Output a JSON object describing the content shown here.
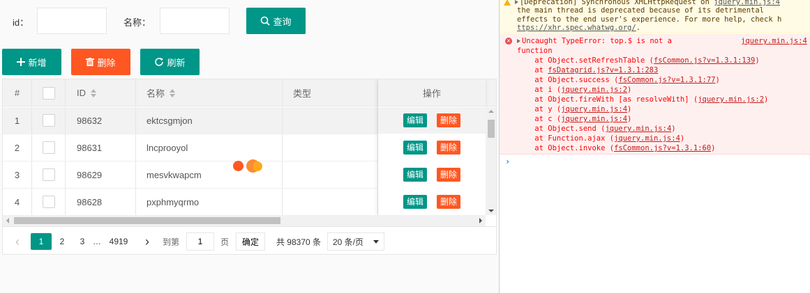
{
  "search": {
    "id_label": "id：",
    "id_value": "",
    "name_label": "名称：",
    "name_value": "",
    "query_button": "查询"
  },
  "toolbar": {
    "add_button": "新增",
    "delete_button": "删除",
    "refresh_button": "刷新"
  },
  "table": {
    "columns": {
      "index": "#",
      "id": "ID",
      "name": "名称",
      "type": "类型",
      "ops": "操作"
    },
    "rows": [
      {
        "index": "1",
        "id": "98632",
        "name": "ektcsgmjon",
        "type": ""
      },
      {
        "index": "2",
        "id": "98631",
        "name": "lncprooyol",
        "type": ""
      },
      {
        "index": "3",
        "id": "98629",
        "name": "mesvkwapcm",
        "type": ""
      },
      {
        "index": "4",
        "id": "98628",
        "name": "pxphmyqrmo",
        "type": ""
      }
    ],
    "edit_label": "编辑",
    "delete_label": "删除"
  },
  "pager": {
    "prev": "‹",
    "pages": [
      "1",
      "2",
      "3"
    ],
    "ellipsis": "…",
    "last_page": "4919",
    "next": "›",
    "goto_label": "到第",
    "goto_value": "1",
    "page_unit": "页",
    "confirm": "确定",
    "total": "共 98370 条",
    "page_size": "20 条/页"
  },
  "colors": {
    "primary": "#009688",
    "danger": "#ff5722",
    "error_bg": "#fff0f0",
    "warning_bg": "#fffbe5",
    "error_text": "#ff0000"
  },
  "console": {
    "warning": {
      "line1_prefix": "[Deprecation] Synchronous XMLHttpRequest on ",
      "line1_link": "jquery.min.js:4",
      "line2": "the main thread is deprecated because of its detrimental",
      "line3": "effects to the end user's experience. For more help, check h",
      "line4_link": "ttps://xhr.spec.whatwg.org/",
      "line4_suffix": "."
    },
    "error": {
      "head": "Uncaught TypeError: top.$ is not a",
      "head_link": "jquery.min.js:4",
      "head2": "function",
      "stack": [
        {
          "text": "    at Object.setRefreshTable (",
          "link": "fsCommon.js?v=1.3.1:139",
          "suffix": ")"
        },
        {
          "text": "    at ",
          "link": "fsDatagrid.js?v=1.3.1:283",
          "suffix": ""
        },
        {
          "text": "    at Object.success (",
          "link": "fsCommon.js?v=1.3.1:77",
          "suffix": ")"
        },
        {
          "text": "    at i (",
          "link": "jquery.min.js:2",
          "suffix": ")"
        },
        {
          "text": "    at Object.fireWith [as resolveWith] (",
          "link": "jquery.min.js:2",
          "suffix": ")"
        },
        {
          "text": "    at y (",
          "link": "jquery.min.js:4",
          "suffix": ")"
        },
        {
          "text": "    at c (",
          "link": "jquery.min.js:4",
          "suffix": ")"
        },
        {
          "text": "    at Object.send (",
          "link": "jquery.min.js:4",
          "suffix": ")"
        },
        {
          "text": "    at Function.ajax (",
          "link": "jquery.min.js:4",
          "suffix": ")"
        },
        {
          "text": "    at Object.invoke (",
          "link": "fsCommon.js?v=1.3.1:60",
          "suffix": ")"
        }
      ]
    },
    "prompt": "›"
  }
}
